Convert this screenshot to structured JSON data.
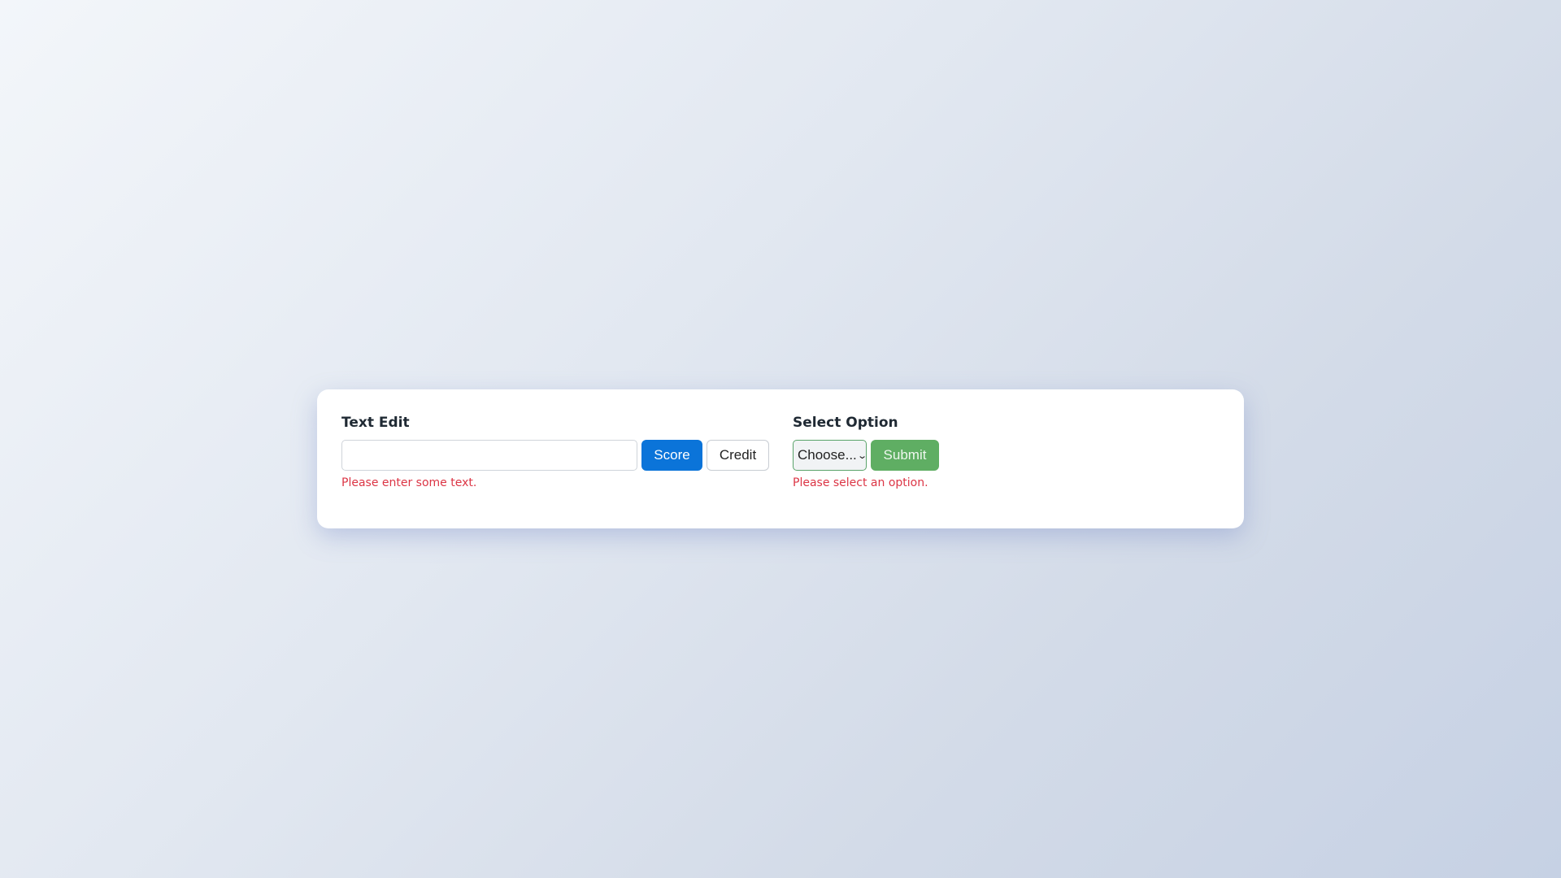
{
  "text_edit": {
    "title": "Text Edit",
    "input_value": "",
    "score_label": "Score",
    "credit_label": "Credit",
    "error": "Please enter some text."
  },
  "select_option": {
    "title": "Select Option",
    "selected": "Choose...",
    "submit_label": "Submit",
    "error": "Please select an option."
  },
  "colors": {
    "primary": "#0b74d9",
    "success": "#5fae63",
    "error": "#dc3545"
  },
  "icons": {
    "select_arrow": "chevron-down-icon"
  }
}
